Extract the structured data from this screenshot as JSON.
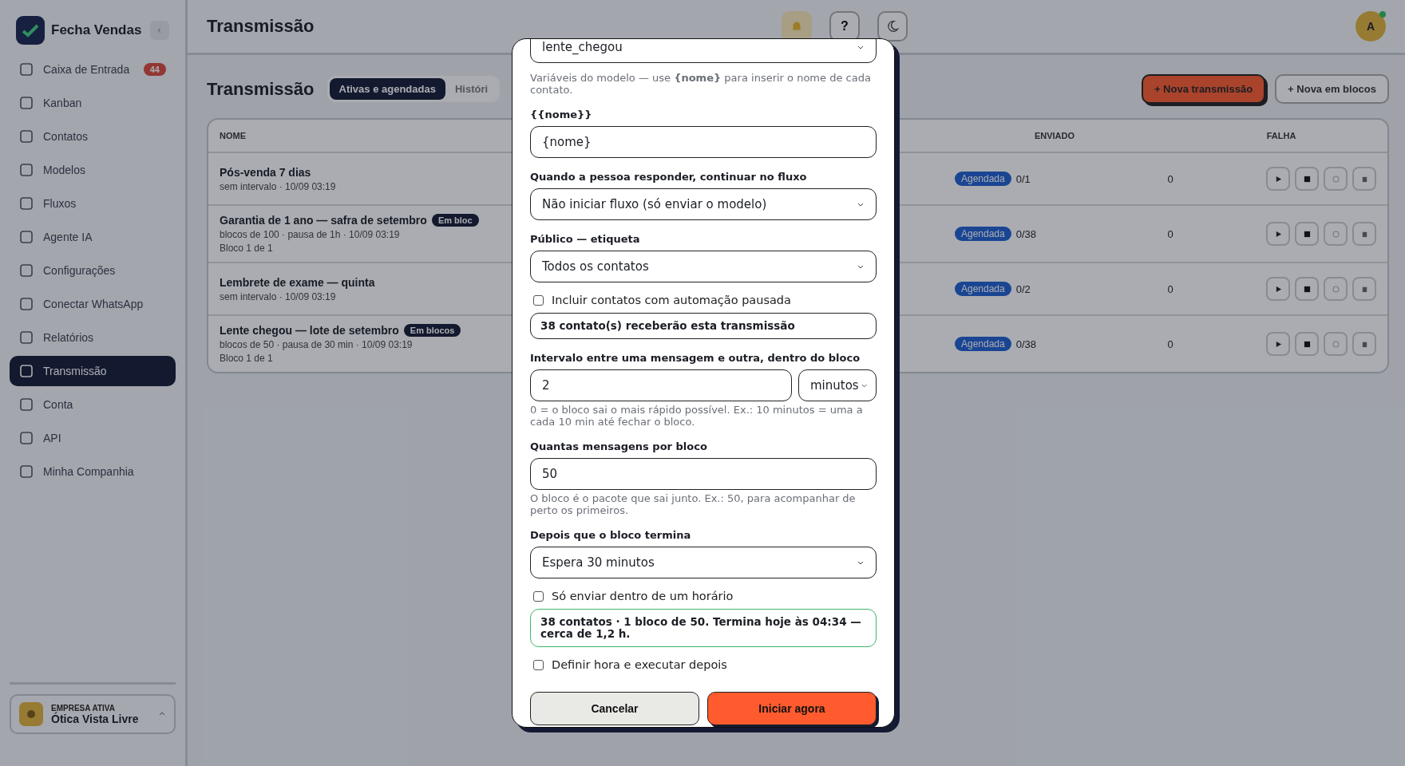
{
  "sidebar": {
    "brand": "Fecha Vendas",
    "items": [
      {
        "label": "Caixa de Entrada",
        "selected": false,
        "badge": "44"
      },
      {
        "label": "Kanban",
        "selected": false
      },
      {
        "label": "Contatos",
        "selected": false
      },
      {
        "label": "Modelos",
        "selected": false
      },
      {
        "label": "Fluxos",
        "selected": false
      },
      {
        "label": "Agente IA",
        "selected": false
      },
      {
        "label": "Configurações",
        "selected": false
      },
      {
        "label": "Conectar WhatsApp",
        "selected": false
      },
      {
        "label": "Relatórios",
        "selected": false
      },
      {
        "label": "Transmissão",
        "selected": true
      },
      {
        "label": "Conta",
        "selected": false
      },
      {
        "label": "API",
        "selected": false
      },
      {
        "label": "Minha Companhia",
        "selected": false
      }
    ],
    "company": {
      "caption": "EMPRESA ATIVA",
      "name": "Ótica Vista Livre"
    }
  },
  "header": {
    "title": "Transmissão",
    "help": "?",
    "avatar": "A"
  },
  "page": {
    "title": "Transmissão",
    "tabs": [
      {
        "label": "Ativas e agendadas",
        "selected": true
      },
      {
        "label": "Históri",
        "selected": false
      }
    ],
    "actions": [
      {
        "label": "+ Nova transmissão",
        "kind": "primary"
      },
      {
        "label": "+ Nova em blocos",
        "kind": "secondary"
      }
    ]
  },
  "table": {
    "columns": [
      "NOME",
      "ENVIADO",
      "FALHA"
    ],
    "rows": [
      {
        "name": "Pós-venda 7 dias",
        "tag": "",
        "lines": [
          "sem intervalo · 10/09 03:19"
        ],
        "status": "Agendada",
        "progress": "0/1",
        "sent": "0"
      },
      {
        "name": "Garantia de 1 ano — safra de setembro",
        "tag": "Em bloc",
        "lines": [
          "blocos de 100 · pausa de 1h · 10/09 03:19",
          "Bloco 1 de 1"
        ],
        "status": "Agendada",
        "progress": "0/38",
        "sent": "0"
      },
      {
        "name": "Lembrete de exame — quinta",
        "tag": "",
        "lines": [
          "sem intervalo · 10/09 03:19"
        ],
        "status": "Agendada",
        "progress": "0/2",
        "sent": "0"
      },
      {
        "name": "Lente chegou — lote de setembro",
        "tag": "Em blocos",
        "lines": [
          "blocos de 50 · pausa de 30 min · 10/09 03:19",
          "Bloco 1 de 1"
        ],
        "status": "Agendada",
        "progress": "0/38",
        "sent": "0"
      }
    ]
  },
  "modal": {
    "fields": [
      {
        "kind": "select",
        "value": "lente_chegou"
      },
      {
        "kind": "note",
        "text": "Variáveis do modelo — use **{nome}** para inserir o nome de cada contato."
      },
      {
        "kind": "input",
        "label": "{{nome}}",
        "value": "{nome}"
      },
      {
        "kind": "select",
        "label": "Quando a pessoa responder, continuar no fluxo",
        "value": "Não iniciar fluxo (só enviar o modelo)"
      },
      {
        "kind": "select",
        "label": "Público — etiqueta",
        "value": "Todos os contatos"
      },
      {
        "kind": "checkbox",
        "label": "Incluir contatos com automação pausada",
        "checked": false
      },
      {
        "kind": "count",
        "text": "38 contato(s) receberão esta transmissão"
      },
      {
        "kind": "interval",
        "label": "Intervalo entre uma mensagem e outra, dentro do bloco",
        "value": "2",
        "unit": "minutos"
      },
      {
        "kind": "hint",
        "text": "0 = o bloco sai o mais rápido possível. Ex.: 10 minutos = uma a cada 10 min até fechar o bloco."
      },
      {
        "kind": "input",
        "label": "Quantas mensagens por bloco",
        "value": "50"
      },
      {
        "kind": "hint",
        "text": "O bloco é o pacote que sai junto. Ex.: 50, para acompanhar de perto os primeiros."
      },
      {
        "kind": "select",
        "label": "Depois que o bloco termina",
        "value": "Espera 30 minutos"
      },
      {
        "kind": "checkbox",
        "label": "Só enviar dentro de um horário",
        "checked": false
      },
      {
        "kind": "estimate",
        "text": "38 contatos · 1 bloco de 50. Termina hoje às 04:34 — cerca de 1,2 h."
      },
      {
        "kind": "checkbox",
        "label": "Definir hora e executar depois",
        "checked": false
      }
    ],
    "buttons": [
      {
        "label": "Cancelar",
        "kind": "secondary"
      },
      {
        "label": "Iniciar agora",
        "kind": "primary"
      }
    ]
  }
}
